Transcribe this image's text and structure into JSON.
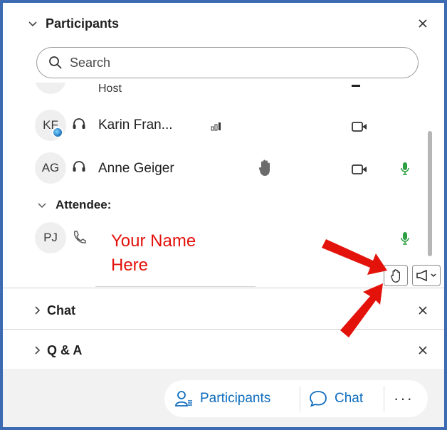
{
  "participants_panel": {
    "title": "Participants",
    "search_placeholder": "Search",
    "host_label": "Host",
    "rows": [
      {
        "initials": "KF",
        "name": "Karin Fran..."
      },
      {
        "initials": "AG",
        "name": "Anne Geiger"
      }
    ],
    "attendee_section": "Attendee:",
    "attendee_row": {
      "initials": "PJ"
    }
  },
  "annotation": {
    "your_name_line1": "Your Name",
    "your_name_line2": "Here"
  },
  "chat_section": {
    "title": "Chat"
  },
  "qa_section": {
    "title": "Q & A"
  },
  "bottom_bar": {
    "participants_label": "Participants",
    "chat_label": "Chat",
    "more_label": "···"
  },
  "colors": {
    "frame_border": "#3d6bb3",
    "accent_blue": "#0f6cbd",
    "annotation_red": "#e3120b",
    "mic_green": "#2ea043"
  },
  "icons": [
    "chevron-down-icon",
    "chevron-right-icon",
    "close-icon",
    "search-icon",
    "headset-icon",
    "phone-icon",
    "signal-icon",
    "raised-hand-icon",
    "video-icon",
    "microphone-icon",
    "megaphone-icon",
    "participants-icon",
    "chat-bubble-icon",
    "more-icon"
  ]
}
